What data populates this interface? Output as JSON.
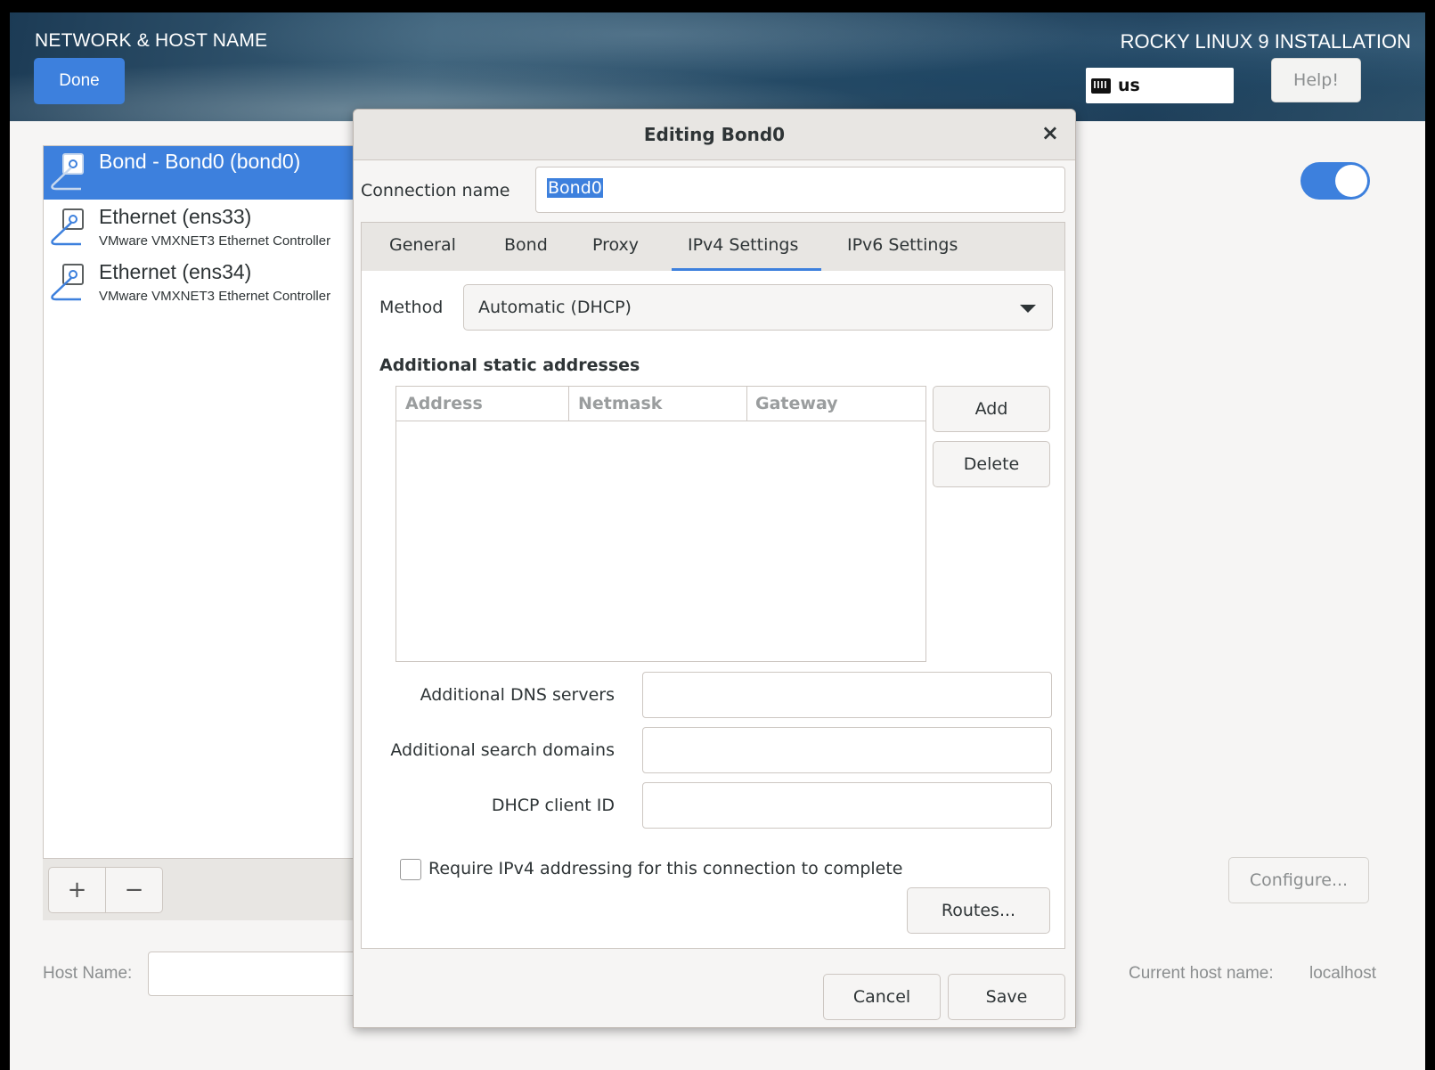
{
  "header": {
    "title": "NETWORK & HOST NAME",
    "installer_title": "ROCKY LINUX 9 INSTALLATION",
    "done_label": "Done",
    "keyboard_layout": "us",
    "help_label": "Help!"
  },
  "connections": [
    {
      "title": "Bond - Bond0 (bond0)",
      "subtitle": "",
      "selected": true
    },
    {
      "title": "Ethernet (ens33)",
      "subtitle": "VMware VMXNET3 Ethernet Controller",
      "selected": false
    },
    {
      "title": "Ethernet (ens34)",
      "subtitle": "VMware VMXNET3 Ethernet Controller",
      "selected": false
    }
  ],
  "list_toolbar": {
    "add_label": "+",
    "remove_label": "−"
  },
  "device_switch": {
    "on": true
  },
  "configure_label": "Configure...",
  "hostname": {
    "label": "Host Name:",
    "value": "",
    "current_label": "Current host name:",
    "current_value": "localhost"
  },
  "dialog": {
    "title": "Editing Bond0",
    "close_glyph": "×",
    "connection_name_label": "Connection name",
    "connection_name_value": "Bond0",
    "tabs": [
      "General",
      "Bond",
      "Proxy",
      "IPv4 Settings",
      "IPv6 Settings"
    ],
    "active_tab": "IPv4 Settings",
    "method_label": "Method",
    "method_value": "Automatic (DHCP)",
    "static_heading": "Additional static addresses",
    "table_columns": [
      "Address",
      "Netmask",
      "Gateway"
    ],
    "add_label": "Add",
    "delete_label": "Delete",
    "dns_label": "Additional DNS servers",
    "search_domains_label": "Additional search domains",
    "dhcp_client_id_label": "DHCP client ID",
    "require_label": "Require IPv4 addressing for this connection to complete",
    "require_checked": false,
    "routes_label": "Routes...",
    "cancel_label": "Cancel",
    "save_label": "Save"
  },
  "colors": {
    "accent": "#3d80dd",
    "background": "#f6f5f4"
  }
}
